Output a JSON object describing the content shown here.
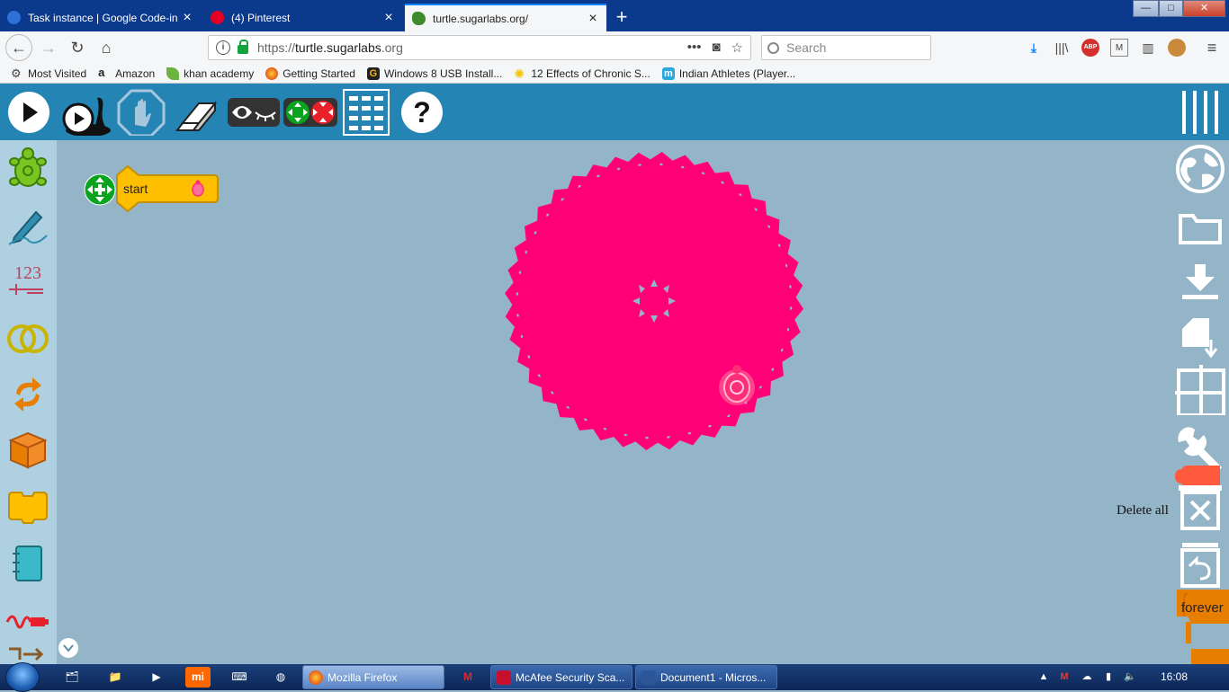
{
  "browser": {
    "tabs": [
      {
        "label": "Task instance | Google Code-in",
        "icon": "google-code-in-icon"
      },
      {
        "label": "(4) Pinterest",
        "icon": "pinterest-icon"
      },
      {
        "label": "turtle.sugarlabs.org/",
        "icon": "turtle-icon"
      }
    ],
    "url_prefix": "https://",
    "url_host": "turtle.sugarlabs",
    "url_suffix": ".org",
    "search_placeholder": "Search",
    "url_menu_dots": "•••",
    "bookmarks": [
      {
        "label": "Most Visited",
        "icon": "gear-icon"
      },
      {
        "label": "Amazon",
        "icon": "amazon-icon"
      },
      {
        "label": "khan academy",
        "icon": "leaf-icon"
      },
      {
        "label": "Getting Started",
        "icon": "firefox-icon"
      },
      {
        "label": "Windows 8 USB Install...",
        "icon": "g-icon"
      },
      {
        "label": "12 Effects of Chronic S...",
        "icon": "sun-icon"
      },
      {
        "label": "Indian Athletes (Player...",
        "icon": "m-icon"
      }
    ],
    "toolbar_badge": "ABP",
    "window_buttons": {
      "minimize": "—",
      "maximize": "□",
      "close": "✕"
    }
  },
  "app": {
    "start_block_label": "start",
    "forever_block_label": "forever",
    "delete_all_tooltip": "Delete all",
    "palette_number_label": "123",
    "accent_colors": {
      "toolbar": "#2484b4",
      "palette": "#aed0e0",
      "canvas": "#94b5c8",
      "drawing": "#ff0077",
      "start_block": "#fdbf00",
      "forever_block": "#e87e00"
    }
  },
  "taskbar": {
    "items": [
      {
        "label": "Mozilla Firefox",
        "icon": "firefox-icon",
        "active": true
      },
      {
        "label": "McAfee Security Sca...",
        "icon": "mcafee-icon",
        "active": false
      },
      {
        "label": "Document1 - Micros...",
        "icon": "word-icon",
        "active": false
      }
    ],
    "clock": "16:08"
  }
}
